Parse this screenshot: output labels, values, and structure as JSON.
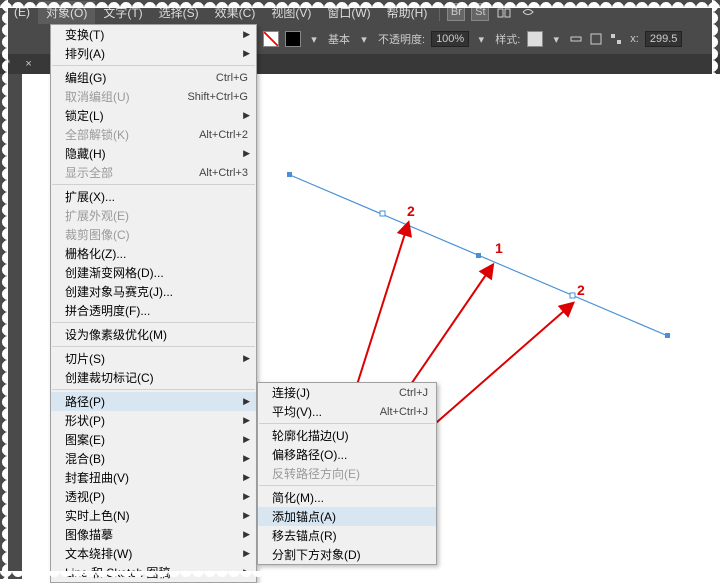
{
  "menubar": {
    "items": [
      {
        "label": "(E)"
      },
      {
        "label": "对象(O)"
      },
      {
        "label": "文字(T)"
      },
      {
        "label": "选择(S)"
      },
      {
        "label": "效果(C)"
      },
      {
        "label": "视图(V)"
      },
      {
        "label": "窗口(W)"
      },
      {
        "label": "帮助(H)"
      }
    ],
    "icon_br": "Br",
    "icon_st": "St"
  },
  "optionbar": {
    "basic": "基本",
    "opacity_label": "不透明度:",
    "opacity_value": "100%",
    "style_label": "样式:",
    "x_label": "x:",
    "x_value": "299.5"
  },
  "tabbar": {
    "indicator": "*",
    "close": "×"
  },
  "dropdown": {
    "items": [
      {
        "label": "变换(T)",
        "sub": true
      },
      {
        "label": "排列(A)",
        "sub": true
      },
      {
        "sep": true
      },
      {
        "label": "编组(G)",
        "shortcut": "Ctrl+G"
      },
      {
        "label": "取消编组(U)",
        "shortcut": "Shift+Ctrl+G",
        "disabled": true
      },
      {
        "label": "锁定(L)",
        "sub": true
      },
      {
        "label": "全部解锁(K)",
        "shortcut": "Alt+Ctrl+2",
        "disabled": true
      },
      {
        "label": "隐藏(H)",
        "sub": true
      },
      {
        "label": "显示全部",
        "shortcut": "Alt+Ctrl+3",
        "disabled": true
      },
      {
        "sep": true
      },
      {
        "label": "扩展(X)..."
      },
      {
        "label": "扩展外观(E)",
        "disabled": true
      },
      {
        "label": "裁剪图像(C)",
        "disabled": true
      },
      {
        "label": "栅格化(Z)..."
      },
      {
        "label": "创建渐变网格(D)..."
      },
      {
        "label": "创建对象马赛克(J)..."
      },
      {
        "label": "拼合透明度(F)..."
      },
      {
        "sep": true
      },
      {
        "label": "设为像素级优化(M)"
      },
      {
        "sep": true
      },
      {
        "label": "切片(S)",
        "sub": true
      },
      {
        "label": "创建裁切标记(C)"
      },
      {
        "sep": true
      },
      {
        "label": "路径(P)",
        "sub": true,
        "highlight": true
      },
      {
        "label": "形状(P)",
        "sub": true
      },
      {
        "label": "图案(E)",
        "sub": true
      },
      {
        "label": "混合(B)",
        "sub": true
      },
      {
        "label": "封套扭曲(V)",
        "sub": true
      },
      {
        "label": "透视(P)",
        "sub": true
      },
      {
        "label": "实时上色(N)",
        "sub": true
      },
      {
        "label": "图像描摹",
        "sub": true
      },
      {
        "label": "文本绕排(W)",
        "sub": true
      },
      {
        "label": "Line 和 Sketch 图稿",
        "sub": true
      }
    ]
  },
  "submenu": {
    "items": [
      {
        "label": "连接(J)",
        "shortcut": "Ctrl+J"
      },
      {
        "label": "平均(V)...",
        "shortcut": "Alt+Ctrl+J"
      },
      {
        "sep": true
      },
      {
        "label": "轮廓化描边(U)"
      },
      {
        "label": "偏移路径(O)..."
      },
      {
        "label": "反转路径方向(E)",
        "disabled": true
      },
      {
        "sep": true
      },
      {
        "label": "简化(M)..."
      },
      {
        "label": "添加锚点(A)",
        "highlight": true
      },
      {
        "label": "移去锚点(R)"
      },
      {
        "label": "分割下方对象(D)"
      }
    ]
  },
  "annotations": {
    "p1": "2",
    "p2": "1",
    "p3": "2"
  }
}
